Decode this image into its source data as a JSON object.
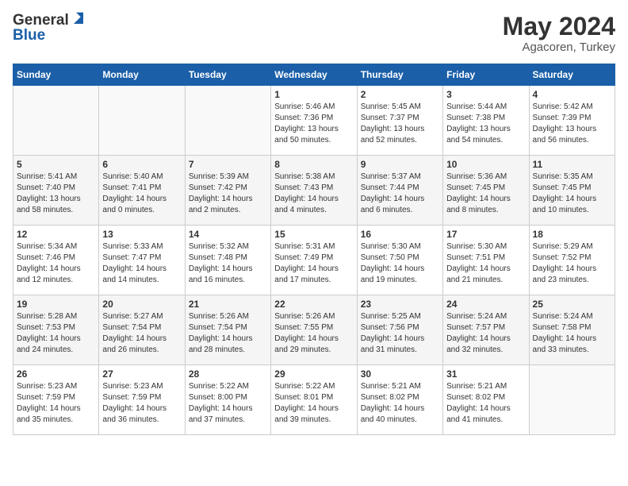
{
  "logo": {
    "general": "General",
    "blue": "Blue"
  },
  "title": {
    "month_year": "May 2024",
    "location": "Agacoren, Turkey"
  },
  "days_of_week": [
    "Sunday",
    "Monday",
    "Tuesday",
    "Wednesday",
    "Thursday",
    "Friday",
    "Saturday"
  ],
  "weeks": [
    [
      {
        "day": "",
        "content": ""
      },
      {
        "day": "",
        "content": ""
      },
      {
        "day": "",
        "content": ""
      },
      {
        "day": "1",
        "content": "Sunrise: 5:46 AM\nSunset: 7:36 PM\nDaylight: 13 hours\nand 50 minutes."
      },
      {
        "day": "2",
        "content": "Sunrise: 5:45 AM\nSunset: 7:37 PM\nDaylight: 13 hours\nand 52 minutes."
      },
      {
        "day": "3",
        "content": "Sunrise: 5:44 AM\nSunset: 7:38 PM\nDaylight: 13 hours\nand 54 minutes."
      },
      {
        "day": "4",
        "content": "Sunrise: 5:42 AM\nSunset: 7:39 PM\nDaylight: 13 hours\nand 56 minutes."
      }
    ],
    [
      {
        "day": "5",
        "content": "Sunrise: 5:41 AM\nSunset: 7:40 PM\nDaylight: 13 hours\nand 58 minutes."
      },
      {
        "day": "6",
        "content": "Sunrise: 5:40 AM\nSunset: 7:41 PM\nDaylight: 14 hours\nand 0 minutes."
      },
      {
        "day": "7",
        "content": "Sunrise: 5:39 AM\nSunset: 7:42 PM\nDaylight: 14 hours\nand 2 minutes."
      },
      {
        "day": "8",
        "content": "Sunrise: 5:38 AM\nSunset: 7:43 PM\nDaylight: 14 hours\nand 4 minutes."
      },
      {
        "day": "9",
        "content": "Sunrise: 5:37 AM\nSunset: 7:44 PM\nDaylight: 14 hours\nand 6 minutes."
      },
      {
        "day": "10",
        "content": "Sunrise: 5:36 AM\nSunset: 7:45 PM\nDaylight: 14 hours\nand 8 minutes."
      },
      {
        "day": "11",
        "content": "Sunrise: 5:35 AM\nSunset: 7:45 PM\nDaylight: 14 hours\nand 10 minutes."
      }
    ],
    [
      {
        "day": "12",
        "content": "Sunrise: 5:34 AM\nSunset: 7:46 PM\nDaylight: 14 hours\nand 12 minutes."
      },
      {
        "day": "13",
        "content": "Sunrise: 5:33 AM\nSunset: 7:47 PM\nDaylight: 14 hours\nand 14 minutes."
      },
      {
        "day": "14",
        "content": "Sunrise: 5:32 AM\nSunset: 7:48 PM\nDaylight: 14 hours\nand 16 minutes."
      },
      {
        "day": "15",
        "content": "Sunrise: 5:31 AM\nSunset: 7:49 PM\nDaylight: 14 hours\nand 17 minutes."
      },
      {
        "day": "16",
        "content": "Sunrise: 5:30 AM\nSunset: 7:50 PM\nDaylight: 14 hours\nand 19 minutes."
      },
      {
        "day": "17",
        "content": "Sunrise: 5:30 AM\nSunset: 7:51 PM\nDaylight: 14 hours\nand 21 minutes."
      },
      {
        "day": "18",
        "content": "Sunrise: 5:29 AM\nSunset: 7:52 PM\nDaylight: 14 hours\nand 23 minutes."
      }
    ],
    [
      {
        "day": "19",
        "content": "Sunrise: 5:28 AM\nSunset: 7:53 PM\nDaylight: 14 hours\nand 24 minutes."
      },
      {
        "day": "20",
        "content": "Sunrise: 5:27 AM\nSunset: 7:54 PM\nDaylight: 14 hours\nand 26 minutes."
      },
      {
        "day": "21",
        "content": "Sunrise: 5:26 AM\nSunset: 7:54 PM\nDaylight: 14 hours\nand 28 minutes."
      },
      {
        "day": "22",
        "content": "Sunrise: 5:26 AM\nSunset: 7:55 PM\nDaylight: 14 hours\nand 29 minutes."
      },
      {
        "day": "23",
        "content": "Sunrise: 5:25 AM\nSunset: 7:56 PM\nDaylight: 14 hours\nand 31 minutes."
      },
      {
        "day": "24",
        "content": "Sunrise: 5:24 AM\nSunset: 7:57 PM\nDaylight: 14 hours\nand 32 minutes."
      },
      {
        "day": "25",
        "content": "Sunrise: 5:24 AM\nSunset: 7:58 PM\nDaylight: 14 hours\nand 33 minutes."
      }
    ],
    [
      {
        "day": "26",
        "content": "Sunrise: 5:23 AM\nSunset: 7:59 PM\nDaylight: 14 hours\nand 35 minutes."
      },
      {
        "day": "27",
        "content": "Sunrise: 5:23 AM\nSunset: 7:59 PM\nDaylight: 14 hours\nand 36 minutes."
      },
      {
        "day": "28",
        "content": "Sunrise: 5:22 AM\nSunset: 8:00 PM\nDaylight: 14 hours\nand 37 minutes."
      },
      {
        "day": "29",
        "content": "Sunrise: 5:22 AM\nSunset: 8:01 PM\nDaylight: 14 hours\nand 39 minutes."
      },
      {
        "day": "30",
        "content": "Sunrise: 5:21 AM\nSunset: 8:02 PM\nDaylight: 14 hours\nand 40 minutes."
      },
      {
        "day": "31",
        "content": "Sunrise: 5:21 AM\nSunset: 8:02 PM\nDaylight: 14 hours\nand 41 minutes."
      },
      {
        "day": "",
        "content": ""
      }
    ]
  ]
}
